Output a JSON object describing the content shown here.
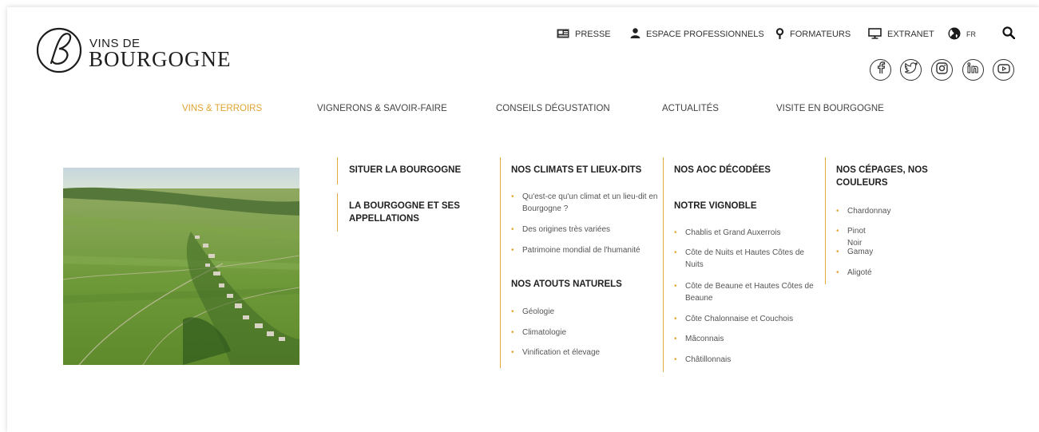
{
  "logo": {
    "small_text": "VINS DE",
    "big_text": "BOURGOGNE"
  },
  "topnav": {
    "presse": "PRESSE",
    "espace_pro": "ESPACE PROFESSIONNELS",
    "formateurs": "FORMATEURS",
    "extranet": "EXTRANET",
    "language": "FR"
  },
  "mainnav": [
    {
      "label": "VINS & TERROIRS"
    },
    {
      "label": "VIGNERONS & SAVOIR-FAIRE"
    },
    {
      "label": "CONSEILS DÉGUSTATION"
    },
    {
      "label": "ACTUALITÉS"
    },
    {
      "label": "VISITE EN BOURGOGNE"
    }
  ],
  "menu": {
    "col1": {
      "heading_a": "SITUER LA BOURGOGNE",
      "heading_b": "LA BOURGOGNE ET SES APPELLATIONS"
    },
    "col2": {
      "heading_a": "NOS CLIMATS ET LIEUX-DITS",
      "items_a": [
        "Qu'est-ce qu'un climat et un lieu-dit en Bourgogne ?",
        "Des origines très variées",
        "Patrimoine mondial de l'humanité"
      ],
      "heading_b": "NOS ATOUTS NATURELS",
      "items_b": [
        "Géologie",
        "Climatologie",
        "Vinification et élevage"
      ]
    },
    "col3": {
      "heading_a": "NOS AOC DÉCODÉES",
      "heading_b": "NOTRE VIGNOBLE",
      "items_b": [
        "Chablis et Grand Auxerrois",
        "Côte de Nuits et Hautes Côtes de Nuits",
        "Côte de Beaune et Hautes Côtes de Beaune",
        "Côte Chalonnaise et Couchois",
        "Mâconnais",
        "Châtillonnais"
      ]
    },
    "col4": {
      "heading": "NOS CÉPAGES, NOS COULEURS",
      "items": [
        "Chardonnay",
        "Pinot Noir",
        "Gamay",
        "Aligoté"
      ]
    }
  },
  "colors": {
    "accent": "#e2a93b",
    "active_nav": "#e0a431",
    "text": "#222222"
  },
  "icons": [
    "newspaper-icon",
    "user-icon",
    "location-pin-icon",
    "monitor-icon",
    "globe-icon",
    "search-icon",
    "facebook-icon",
    "twitter-icon",
    "instagram-icon",
    "linkedin-icon",
    "youtube-icon"
  ]
}
